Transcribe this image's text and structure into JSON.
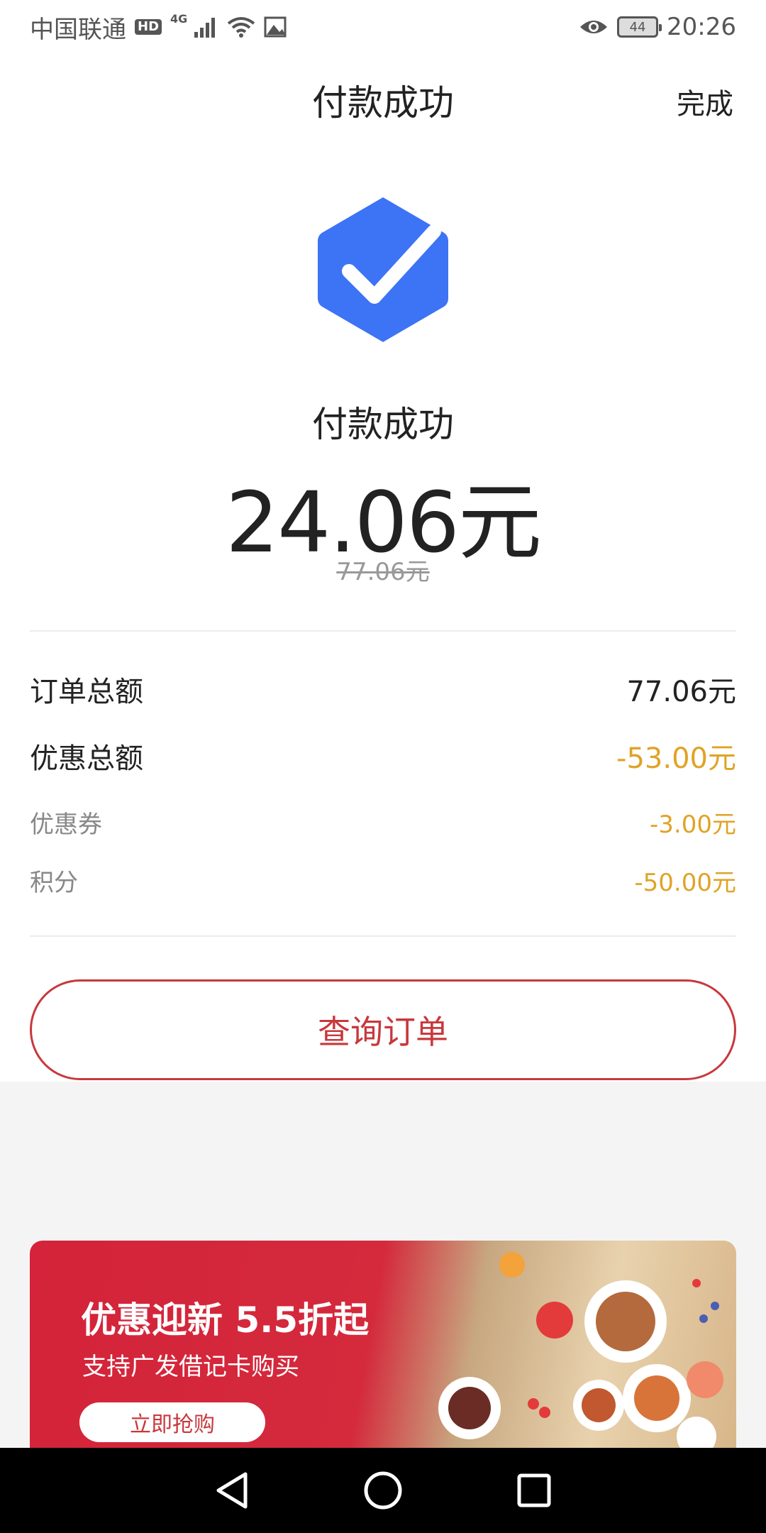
{
  "status_bar": {
    "carrier": "中国联通",
    "hd_badge": "HD",
    "network": "4G",
    "battery_level": "44",
    "time": "20:26"
  },
  "header": {
    "title": "付款成功",
    "done_label": "完成"
  },
  "payment": {
    "status_text": "付款成功",
    "paid_amount": "24.06元",
    "original_amount": "77.06元"
  },
  "summary": {
    "order_total_label": "订单总额",
    "order_total_value": "77.06元",
    "discount_total_label": "优惠总额",
    "discount_total_value": "-53.00元",
    "coupon_label": "优惠券",
    "coupon_value": "-3.00元",
    "points_label": "积分",
    "points_value": "-50.00元"
  },
  "actions": {
    "query_order_label": "查询订单"
  },
  "banner": {
    "title": "优惠迎新  5.5折起",
    "subtitle": "支持广发借记卡购买",
    "button_label": "立即抢购"
  },
  "colors": {
    "accent_red": "#c8383c",
    "discount_orange": "#e0a326",
    "success_blue": "#3d73f5"
  }
}
